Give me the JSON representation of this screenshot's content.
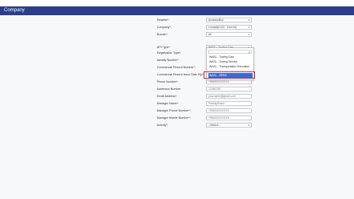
{
  "header": {
    "title": "Company"
  },
  "form": {
    "fields": [
      {
        "label": "Reseller*:",
        "value": "AccessoBox",
        "type": "select"
      },
      {
        "label": "Company*:",
        "value": "Lomadi(0123 - Com.M)",
        "type": "select"
      },
      {
        "label": "Branch*:",
        "value": "All",
        "type": "select"
      },
      {
        "label": "API Type*:",
        "value": "WASL - Towing Cars",
        "type": "select"
      },
      {
        "label": "Registration Type*:",
        "value": "",
        "type": "text"
      },
      {
        "label": "Identity Number*:",
        "value": "",
        "type": "text"
      },
      {
        "label": "Commercial Record Number*:",
        "value": "",
        "type": "text"
      },
      {
        "label": "Commercial Record Issue Date Hijri*:",
        "value": "",
        "type": "text"
      },
      {
        "label": "Phone Number*:",
        "value": "+966XXXXXXXX",
        "type": "text"
      },
      {
        "label": "Extension Number:",
        "value": "12456789",
        "type": "text"
      },
      {
        "label": "Email Address*:",
        "value": "yourname@gmail.com",
        "type": "text"
      },
      {
        "label": "Manager Name*:",
        "value": "Pankaj Basut",
        "type": "text"
      },
      {
        "label": "Manager Phone Number*:",
        "value": "+966XXXXXXXX",
        "type": "text"
      },
      {
        "label": "Manager Mobile Number*:",
        "value": "+966XXXXXXXX",
        "type": "text"
      },
      {
        "label": "Activity*:",
        "value": "--Select--",
        "type": "select"
      }
    ]
  },
  "dropdown": {
    "search_placeholder": "",
    "options": [
      "WASL - Towing Cars",
      "WASL - Towing Service",
      "WASL - Transportation Education",
      "WASL - SERA"
    ],
    "selected": "WASL - SERA"
  },
  "colors": {
    "header": "#2b3d8c",
    "selected": "#2f6fd8",
    "highlight": "#e0262b"
  }
}
